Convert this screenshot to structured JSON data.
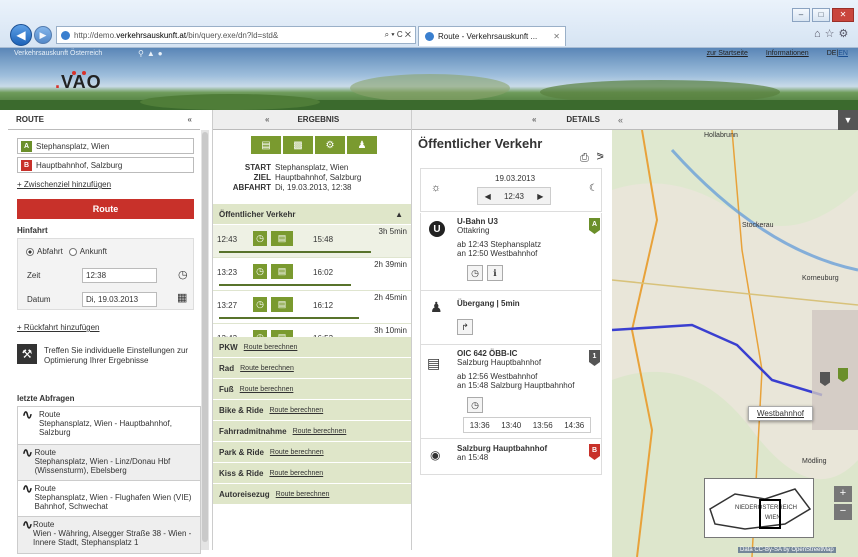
{
  "browser": {
    "url_prefix": "http://demo.",
    "url_domain": "verkehrsauskunft.at",
    "url_rest": "/bin/query.exe/dn?ld=std&",
    "url_controls": "⌕ ▾ C ✕",
    "tab_title": "Route - Verkehrsauskunft ...",
    "tab_close": "✕"
  },
  "site": {
    "name": "Verkehrsauskunft Österreich",
    "logo": "VAO",
    "links": [
      "zur Startseite",
      "Informationen"
    ],
    "lang_de": "DE",
    "lang_sep": "|",
    "lang_en": "EN"
  },
  "route_panel": {
    "tab": "ROUTE",
    "collapse": "«",
    "from_badge": "A",
    "from": "Stephansplatz, Wien",
    "to_badge": "B",
    "to": "Hauptbahnhof, Salzburg",
    "add_via": "+ Zwischenziel hinzufügen",
    "route_button": "Route",
    "hinfahrt_label": "Hinfahrt",
    "abfahrt_option": "Abfahrt",
    "ankunft_option": "Ankunft",
    "zeit_label": "Zeit",
    "zeit_value": "12:38",
    "datum_label": "Datum",
    "datum_value": "Di, 19.03.2013",
    "add_return": "+ Rückfahrt hinzufügen",
    "settings_text": "Treffen Sie individuelle Einstellungen zur Optimierung Ihrer Ergebnisse",
    "recent_title": "letzte Abfragen",
    "recent": [
      {
        "title": "Route",
        "text": "Stephansplatz, Wien - Hauptbahnhof, Salzburg"
      },
      {
        "title": "Route",
        "text": "Stephansplatz, Wien - Linz/Donau Hbf (Wissensturm), Ebelsberg"
      },
      {
        "title": "Route",
        "text": "Stephansplatz, Wien - Flughafen Wien (VIE) Bahnhof, Schwechat"
      },
      {
        "title": "Route",
        "text": "Wien - Währing, Alsegger Straße 38 - Wien - Innere Stadt, Stephansplatz 1"
      }
    ]
  },
  "results_panel": {
    "tab": "ERGEBNIS",
    "collapse": "«",
    "start_label": "START",
    "start_value": "Stephansplatz, Wien",
    "ziel_label": "ZIEL",
    "ziel_value": "Hauptbahnhof, Salzburg",
    "abfahrt_label": "ABFAHRT",
    "abfahrt_value": "Di, 19.03.2013, 12:38",
    "oev_title": "Öffentlicher Verkehr",
    "connections": [
      {
        "dep": "12:43",
        "arr": "15:48",
        "dur": "3h 5min"
      },
      {
        "dep": "13:23",
        "arr": "16:02",
        "dur": "2h 39min"
      },
      {
        "dep": "13:27",
        "arr": "16:12",
        "dur": "2h 45min"
      },
      {
        "dep": "13:43",
        "arr": "16:53",
        "dur": "3h 10min"
      }
    ],
    "categories": [
      {
        "label": "PKW",
        "link": "Route berechnen"
      },
      {
        "label": "Rad",
        "link": "Route berechnen"
      },
      {
        "label": "Fuß",
        "link": "Route berechnen"
      },
      {
        "label": "Bike & Ride",
        "link": "Route berechnen"
      },
      {
        "label": "Fahrradmitnahme",
        "link": "Route berechnen"
      },
      {
        "label": "Park & Ride",
        "link": "Route berechnen"
      },
      {
        "label": "Kiss & Ride",
        "link": "Route berechnen"
      },
      {
        "label": "Autoreisezug",
        "link": "Route berechnen"
      }
    ]
  },
  "details_panel": {
    "tab": "DETAILS",
    "collapse": "«",
    "title": "Öffentlicher Verkehr",
    "date": "19.03.2013",
    "time": "12:43",
    "leg1": {
      "line": "U-Bahn U3",
      "dir": "Ottakring",
      "dep": "ab 12:43 Stephansplatz",
      "arr": "an 12:50 Westbahnhof",
      "badge": "A"
    },
    "walk": {
      "label": "Übergang | 5min"
    },
    "leg2": {
      "line": "OIC 642 ÖBB-IC",
      "dir": "Salzburg Hauptbahnhof",
      "dep": "ab 12:56 Westbahnhof",
      "arr": "an 15:48 Salzburg Hauptbahnhof",
      "badge": "1"
    },
    "times": [
      "13:36",
      "13:40",
      "13:56",
      "14:36"
    ],
    "dest": {
      "name": "Salzburg Hauptbahnhof",
      "arr": "an 15:48",
      "badge": "B"
    }
  },
  "map": {
    "towns": [
      "Hollabrunn",
      "Stockerau",
      "Korneuburg",
      "Mödling",
      "NIEDERÖSTERREICH",
      "WIEN"
    ],
    "popup": "Westbahnhof",
    "attribution": "Data CC-By-SA by OpenStreetMap",
    "zoom_in": "+",
    "zoom_out": "−",
    "menu": "▼"
  },
  "colors": {
    "route_red": "#c8312a",
    "accent_green": "#7a9a2f",
    "route_blue": "#3a3fd0"
  }
}
